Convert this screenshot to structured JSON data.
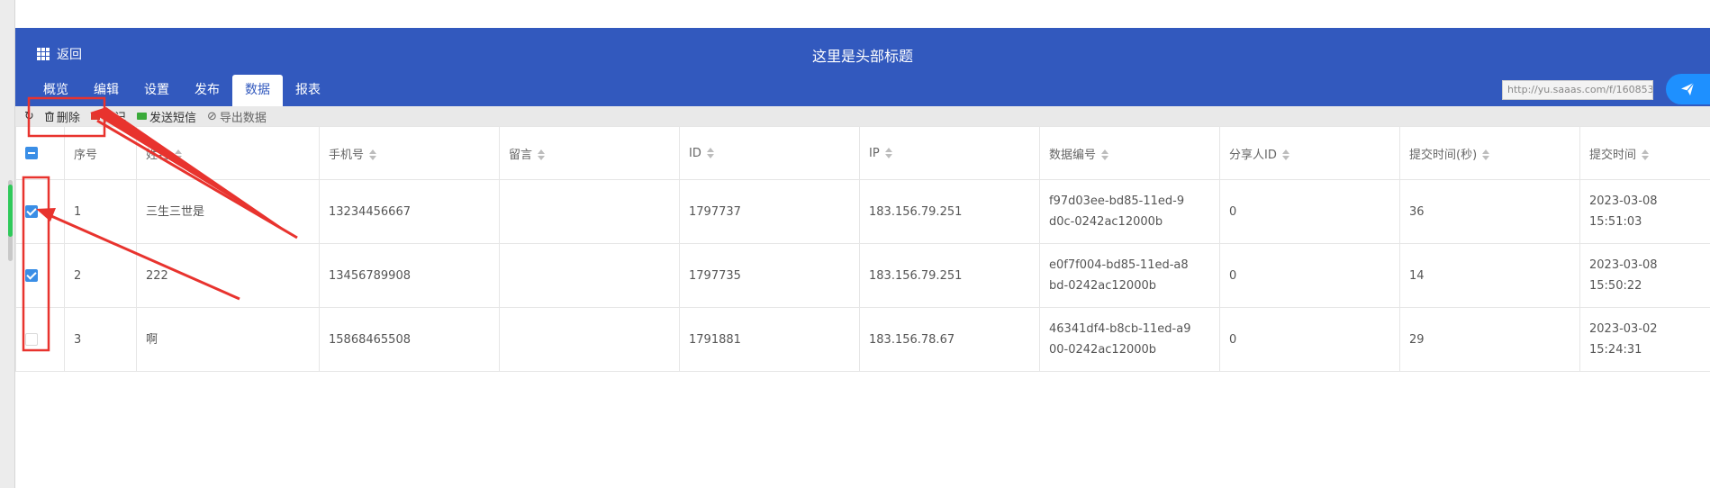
{
  "header": {
    "back_label": "返回",
    "title": "这里是头部标题",
    "url": "http://yu.saaas.com/f/160853",
    "color": "#3259be"
  },
  "tabs": [
    {
      "label": "概览"
    },
    {
      "label": "编辑"
    },
    {
      "label": "设置"
    },
    {
      "label": "发布"
    },
    {
      "label": "数据",
      "active": true
    },
    {
      "label": "报表"
    }
  ],
  "toolbar": {
    "delete_label": "删除",
    "mark_label": "标记",
    "sms_label": "发送短信",
    "export_label": "导出数据"
  },
  "table": {
    "columns": [
      "序号",
      "姓名",
      "手机号",
      "留言",
      "ID",
      "IP",
      "数据编号",
      "分享人ID",
      "提交时间(秒)",
      "提交时间"
    ],
    "rows": [
      {
        "checked": true,
        "no": "1",
        "name": "三生三世是",
        "phone": "13234456667",
        "message": "",
        "id": "1797737",
        "ip": "183.156.79.251",
        "data_no": "f97d03ee-bd85-11ed-9d0c-0242ac12000b",
        "sharer": "0",
        "seconds": "36",
        "time": "2023-03-08 15:51:03"
      },
      {
        "checked": true,
        "no": "2",
        "name": "222",
        "phone": "13456789908",
        "message": "",
        "id": "1797735",
        "ip": "183.156.79.251",
        "data_no": "e0f7f004-bd85-11ed-a8bd-0242ac12000b",
        "sharer": "0",
        "seconds": "14",
        "time": "2023-03-08 15:50:22"
      },
      {
        "checked": false,
        "no": "3",
        "name": "啊",
        "phone": "15868465508",
        "message": "",
        "id": "1791881",
        "ip": "183.156.78.67",
        "data_no": "46341df4-b8cb-11ed-a900-0242ac12000b",
        "sharer": "0",
        "seconds": "29",
        "time": "2023-03-02 15:24:31"
      }
    ]
  },
  "annotation_color": "#e8332e"
}
